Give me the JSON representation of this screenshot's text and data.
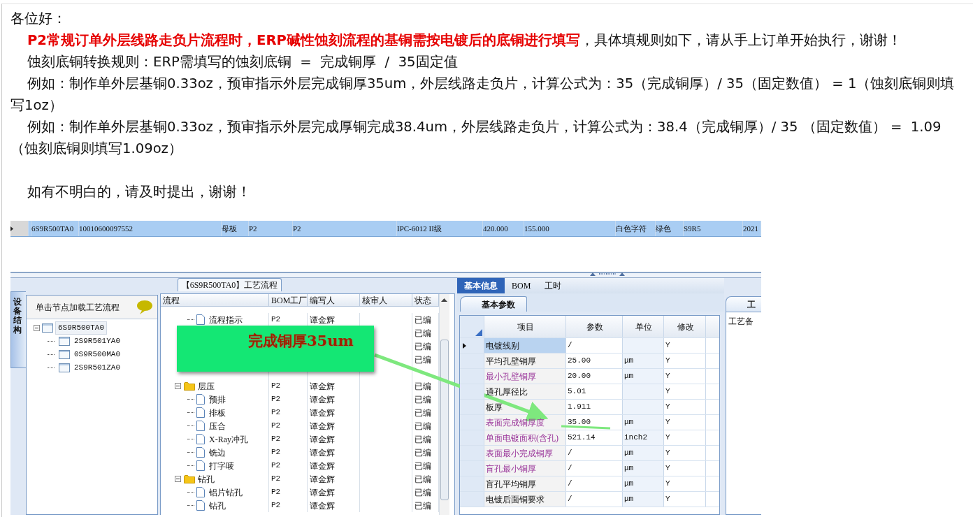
{
  "greeting": "各位好：",
  "paragraphs": [
    "**P2常规订单外层线路走负片流程时，ERP碱性蚀刻流程的基铜需按电镀后的底铜进行填写**，具体填规则如下，请从手上订单开始执行，谢谢！",
    "蚀刻底铜转换规则：ERP需填写的蚀刻底铜  =  完成铜厚  /  35固定值",
    "例如：制作单外层基铜0.33oz，预审指示外层完成铜厚35um，外层线路走负片，计算公式为：35（完成铜厚）/ 35（固定数值） = 1（蚀刻底铜则填写1oz）",
    "例如：制作单外层基铜0.33oz，预审指示外层完成厚铜完成38.4um，外层线路走负片，计算公式为：38.4（完成铜厚）/ 35 （固定数值） =  1.09 （蚀刻底铜则填写1.09oz）"
  ],
  "closing": "如有不明白的，请及时提出，谢谢！",
  "order_row": {
    "selected": true,
    "cells": [
      "6S9R500TA0",
      "10010600097552",
      "母板",
      "P2",
      "P2",
      "IPC-6012 II级",
      "420.000",
      "155.000",
      "白色字符",
      "绿色",
      "S9R5",
      "2021"
    ]
  },
  "structure_panel": {
    "side_tab": "设备结构",
    "header": "单击节点加载工艺流程",
    "tree": [
      {
        "label": "6S9R500TA0",
        "selected": true,
        "expanded": true,
        "children": [
          {
            "label": "2S9R501YA0",
            "selected": false
          },
          {
            "label": "0S9R500MA0",
            "selected": false
          },
          {
            "label": "2S9R501ZA0",
            "selected": false
          }
        ]
      }
    ]
  },
  "process_panel": {
    "title": "【6S9R500TA0】工艺流程",
    "columns": [
      "流程",
      "BOM工厂",
      "编写人",
      "核审人",
      "状态"
    ],
    "rows": [
      {
        "kind": "folder-cut",
        "children": [
          {
            "kind": "leaf",
            "name": "流程指示",
            "bom": "P2",
            "writer": "谭金辉",
            "status": "已编"
          },
          {
            "kind": "hidden",
            "status": "已编"
          },
          {
            "kind": "hidden",
            "status": "已编"
          },
          {
            "kind": "hidden",
            "status": "已编"
          },
          {
            "kind": "hidden"
          }
        ]
      },
      {
        "kind": "folder",
        "name": "层压",
        "bom": "P2",
        "writer": "谭金辉",
        "status": "已编",
        "expanded": true,
        "children": [
          {
            "kind": "leaf",
            "name": "预排",
            "bom": "P2",
            "writer": "谭金辉",
            "status": "已编"
          },
          {
            "kind": "leaf",
            "name": "排板",
            "bom": "P2",
            "writer": "谭金辉",
            "status": "已编"
          },
          {
            "kind": "leaf",
            "name": "压合",
            "bom": "P2",
            "writer": "谭金辉",
            "status": "已编"
          },
          {
            "kind": "leaf",
            "name": "X-Ray冲孔",
            "bom": "P2",
            "writer": "谭金辉",
            "status": "已编"
          },
          {
            "kind": "leaf",
            "name": "铣边",
            "bom": "P2",
            "writer": "谭金辉",
            "status": "已编"
          },
          {
            "kind": "leaf",
            "name": "打字唛",
            "bom": "P2",
            "writer": "谭金辉",
            "status": "已编"
          }
        ]
      },
      {
        "kind": "folder",
        "name": "钻孔",
        "bom": "P2",
        "writer": "谭金辉",
        "status": "已编",
        "expanded": true,
        "children": [
          {
            "kind": "leaf",
            "name": "铝片钻孔",
            "bom": "P2",
            "writer": "谭金辉",
            "status": "已编"
          },
          {
            "kind": "leaf",
            "name": "钻孔",
            "bom": "P2",
            "writer": "谭金辉",
            "status": "已编"
          }
        ]
      }
    ]
  },
  "callout": {
    "text": "完成铜厚35um"
  },
  "info_panel": {
    "tabs": [
      {
        "label": "基本信息",
        "selected": true
      },
      {
        "label": "BOM",
        "selected": false
      },
      {
        "label": "工时",
        "selected": false
      }
    ],
    "subtab": "基本参数",
    "columns": [
      "项目",
      "参数",
      "单位",
      "修改"
    ],
    "rows": [
      {
        "item": "电镀线别",
        "value": "/",
        "unit": "",
        "edit": "Y",
        "highlighted": false,
        "selected": true
      },
      {
        "item": "平均孔壁铜厚",
        "value": "25.00",
        "unit": "μm",
        "edit": "Y",
        "highlighted": false,
        "selected": false
      },
      {
        "item": "最小孔壁铜厚",
        "value": "20.00",
        "unit": "μm",
        "edit": "Y",
        "highlighted": true,
        "selected": false
      },
      {
        "item": "通孔厚径比",
        "value": "5.01",
        "unit": "",
        "edit": "Y",
        "highlighted": false,
        "selected": false
      },
      {
        "item": "板厚",
        "value": "1.911",
        "unit": "",
        "edit": "Y",
        "highlighted": false,
        "selected": false
      },
      {
        "item": "表面完成铜厚度",
        "value": "35.00",
        "unit": "μm",
        "edit": "Y",
        "highlighted": true,
        "selected": false
      },
      {
        "item": "单面电镀面积(含孔)",
        "value": "521.14",
        "unit": "inch2",
        "edit": "Y",
        "highlighted": true,
        "selected": false
      },
      {
        "item": "表面最小完成铜厚",
        "value": "/",
        "unit": "μm",
        "edit": "Y",
        "highlighted": true,
        "selected": false
      },
      {
        "item": "盲孔最小铜厚",
        "value": "/",
        "unit": "μm",
        "edit": "Y",
        "highlighted": true,
        "selected": false
      },
      {
        "item": "盲孔平均铜厚",
        "value": "/",
        "unit": "μm",
        "edit": "Y",
        "highlighted": false,
        "selected": false
      },
      {
        "item": "电镀后面铜要求",
        "value": "/",
        "unit": "μm",
        "edit": "Y",
        "highlighted": false,
        "selected": false
      }
    ]
  },
  "notes_panel": {
    "tab": "工",
    "label": "工艺备"
  }
}
